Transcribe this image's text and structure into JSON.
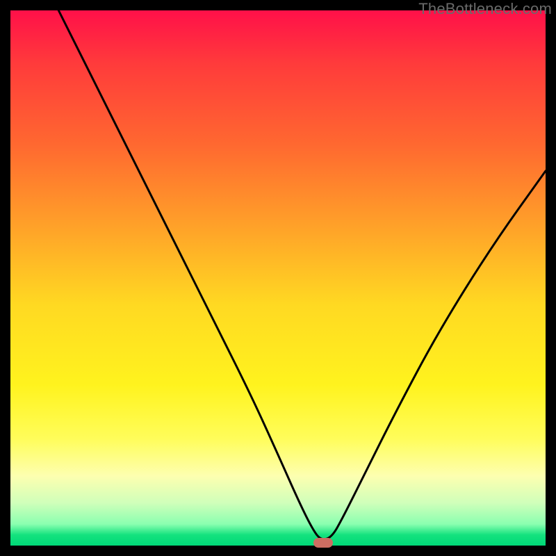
{
  "watermark": "TheBottleneck.com",
  "chart_data": {
    "type": "line",
    "title": "",
    "xlabel": "",
    "ylabel": "",
    "xlim": [
      0,
      100
    ],
    "ylim": [
      0,
      100
    ],
    "series": [
      {
        "name": "bottleneck-curve",
        "x": [
          9,
          15,
          22,
          30,
          38,
          45,
          50,
          54,
          56.5,
          58,
          60,
          62,
          66,
          72,
          80,
          90,
          100
        ],
        "values": [
          100,
          88,
          74,
          58,
          42,
          28,
          17,
          8,
          3,
          1,
          1.5,
          5,
          13,
          25,
          40,
          56,
          70
        ]
      }
    ],
    "marker": {
      "x": 58.5,
      "y": 0.5,
      "color": "#cc6d62"
    },
    "gradient_stops": [
      {
        "pos": 0,
        "color": "#ff1049"
      },
      {
        "pos": 10,
        "color": "#ff3b3b"
      },
      {
        "pos": 25,
        "color": "#ff6830"
      },
      {
        "pos": 40,
        "color": "#ffa029"
      },
      {
        "pos": 55,
        "color": "#ffd922"
      },
      {
        "pos": 70,
        "color": "#fff31e"
      },
      {
        "pos": 80,
        "color": "#fffd5a"
      },
      {
        "pos": 87,
        "color": "#fdffb0"
      },
      {
        "pos": 92,
        "color": "#d0ffba"
      },
      {
        "pos": 96,
        "color": "#8affb0"
      },
      {
        "pos": 98,
        "color": "#14e27e"
      },
      {
        "pos": 100,
        "color": "#00d877"
      }
    ]
  }
}
